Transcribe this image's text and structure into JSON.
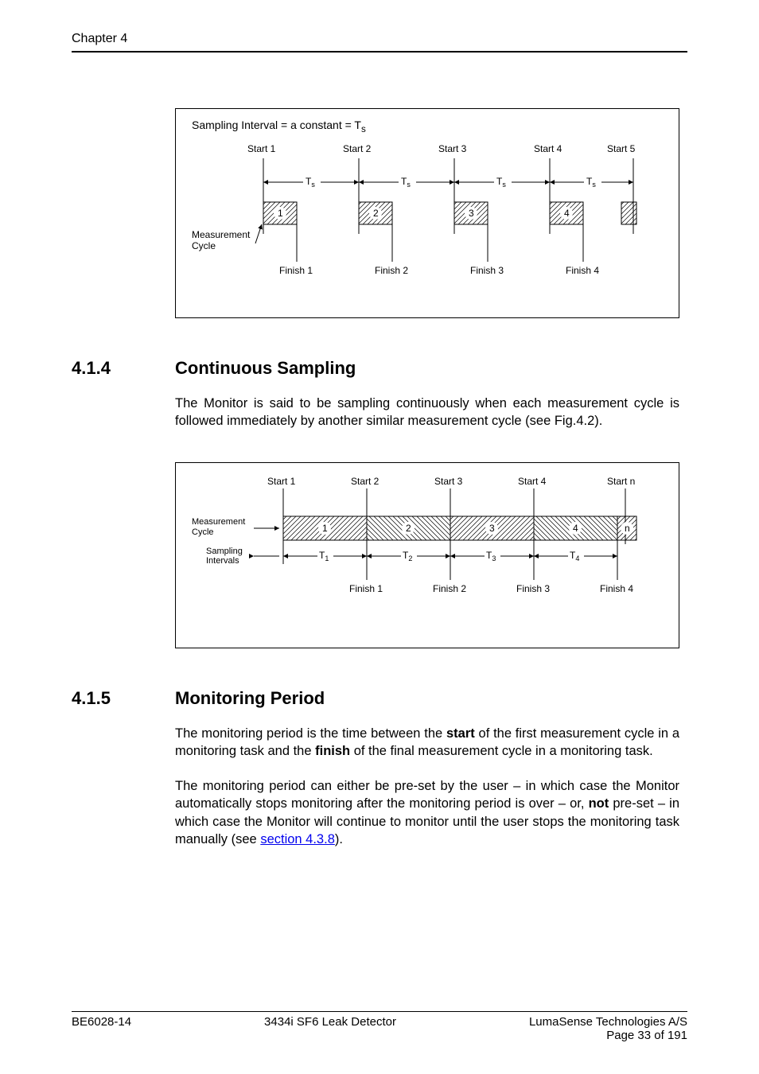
{
  "runhead": "Chapter 4",
  "fig1": {
    "caption": "Sampling Interval = a constant = T",
    "caption_sub": "s",
    "starts": [
      "Start 1",
      "Start 2",
      "Start 3",
      "Start 4",
      "Start 5"
    ],
    "finishes": [
      "Finish 1",
      "Finish 2",
      "Finish 3",
      "Finish 4"
    ],
    "label_left": "Measurement",
    "label_left2": "Cycle",
    "interval_label": "T",
    "interval_sub": "s",
    "box_nums": [
      "1",
      "2",
      "3",
      "4"
    ]
  },
  "sec_414": {
    "num": "4.1.4",
    "title": "Continuous Sampling",
    "para": "The Monitor is said to be sampling continuously when each measurement cycle is followed immediately by another similar measurement cycle (see Fig.4.2)."
  },
  "fig2": {
    "starts": [
      "Start 1",
      "Start 2",
      "Start 3",
      "Start 4",
      "Start n"
    ],
    "finishes": [
      "Finish 1",
      "Finish 2",
      "Finish 3",
      "Finish 4"
    ],
    "label_left": "Measurement",
    "label_left2": "Cycle",
    "label_si": "Sampling",
    "label_si2": "Intervals",
    "t_labels": [
      "T",
      "T",
      "T",
      "T"
    ],
    "t_subs": [
      "1",
      "2",
      "3",
      "4"
    ],
    "box_nums": [
      "1",
      "2",
      "3",
      "4",
      "n"
    ]
  },
  "sec_415": {
    "num": "4.1.5",
    "title": "Monitoring Period",
    "para1_a": "The monitoring period is the time between the ",
    "para1_b": "start",
    "para1_c": " of the first measurement cycle in a monitoring task and the ",
    "para1_d": "finish",
    "para1_e": " of the final measurement cycle in a monitoring task.",
    "para2_a": "The monitoring period can either be pre-set by the user – in which case the Monitor automatically stops monitoring after the monitoring period is over – or, ",
    "para2_b": "not",
    "para2_c": " pre-set – in which case the Monitor will continue to monitor until the user stops the monitoring task manually (see ",
    "para2_link": "section 4.3.8",
    "para2_d": ")."
  },
  "footer": {
    "left": "BE6028-14",
    "center": "3434i SF6 Leak Detector",
    "right1": "LumaSense Technologies A/S",
    "right2": "Page 33 of 191"
  }
}
